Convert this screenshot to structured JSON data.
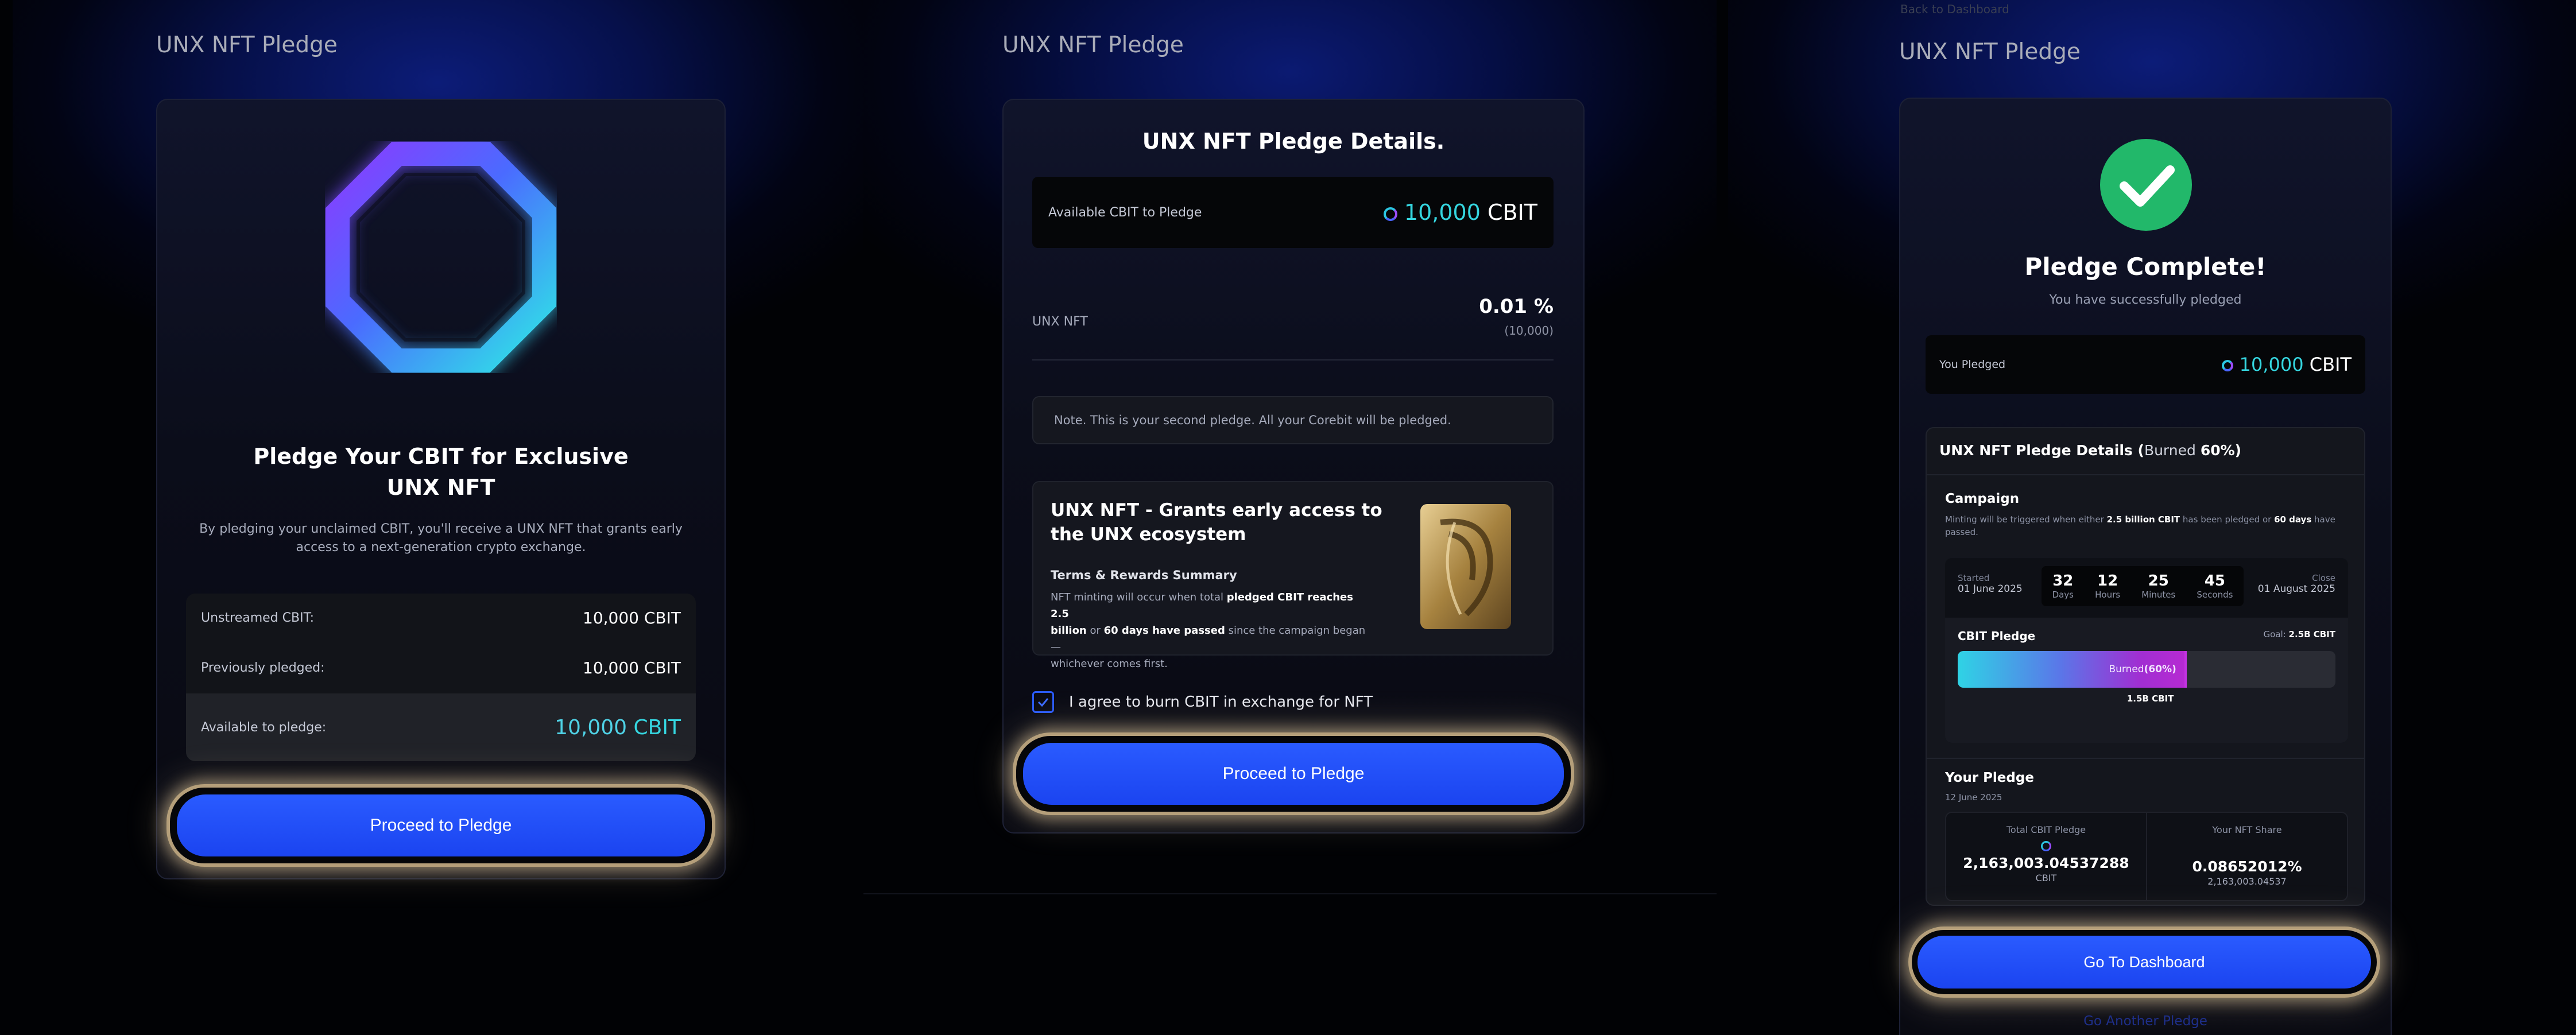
{
  "step1": {
    "title": "UNX NFT Pledge",
    "headline_line1": "Pledge Your CBIT for Exclusive",
    "headline_line2": "UNX NFT",
    "description_line1": "By pledging your unclaimed CBIT, you'll receive a UNX NFT that grants early",
    "description_line2": "access to a next-generation crypto exchange.",
    "rows": [
      {
        "label": "Unstreamed CBIT:",
        "value": "10,000 CBIT"
      },
      {
        "label": "Previously pledged:",
        "value": "10,000 CBIT"
      }
    ],
    "available_label": "Available to pledge:",
    "available_amount": "10,000",
    "available_unit": "CBIT",
    "button": "Proceed to Pledge"
  },
  "step2": {
    "title": "UNX NFT Pledge",
    "heading": "UNX NFT Pledge Details.",
    "available_label": "Available CBIT to Pledge",
    "available_amount": "10,000",
    "available_unit": "CBIT",
    "nft_label": "UNX NFT",
    "nft_percent": "0.01 %",
    "nft_sub": "(10,000)",
    "note": "Note. This is your second pledge. All your Corebit will be pledged.",
    "promo_title_line1": "UNX NFT - Grants early access to",
    "promo_title_line2": "the UNX ecosystem",
    "terms_title": "Terms & Rewards Summary",
    "terms_a": "NFT minting will occur when total ",
    "terms_b": "pledged CBIT reaches 2.5",
    "terms_c": "billion",
    "terms_d": " or ",
    "terms_e": "60 days have passed",
    "terms_f": " since the campaign began —",
    "terms_g": "whichever comes first.",
    "agree": "I agree to burn CBIT in exchange for NFT",
    "button": "Proceed to Pledge"
  },
  "step3": {
    "top_text": "Back to Dashboard",
    "title": "UNX NFT Pledge",
    "complete_title": "Pledge Complete!",
    "complete_sub": "You have successfully pledged",
    "you_pledged_label": "You Pledged",
    "you_pledged_amount": "10,000",
    "you_pledged_unit": "CBIT",
    "details_title": "UNX NFT Pledge Details (",
    "details_burned": "Burned ",
    "details_pct": "60%",
    "details_close": ")",
    "campaign_title": "Campaign",
    "campaign_a": "Minting will be triggered when either ",
    "campaign_b": "2.5 billion CBIT",
    "campaign_c": " has been pledged or ",
    "campaign_d": "60 days",
    "campaign_e": " have",
    "campaign_f": "passed.",
    "started_label": "Started",
    "started_date": "01 June 2025",
    "close_label": "Close",
    "close_date": "01 August 2025",
    "countdown": [
      {
        "n": "32",
        "l": "Days"
      },
      {
        "n": "12",
        "l": "Hours"
      },
      {
        "n": "25",
        "l": "Minutes"
      },
      {
        "n": "45",
        "l": "Seconds"
      }
    ],
    "cbit_pledge_label": "CBIT Pledge",
    "goal_label": "Goal: ",
    "goal_value": "2.5B CBIT",
    "bar_label": "Burned ",
    "bar_pct": "(60%)",
    "bar_progress": 0.6,
    "bar_marker": "1.5B CBIT",
    "your_pledge_title": "Your Pledge",
    "your_pledge_date": "12 June 2025",
    "total_label": "Total CBIT Pledge",
    "total_value": "2,163,003.04537288",
    "total_unit": "CBIT",
    "share_label": "Your NFT Share",
    "share_value": "0.08652012%",
    "share_sub": "2,163,003.04537",
    "button": "Go To Dashboard",
    "another": "Go Another Pledge"
  },
  "colors": {
    "accent": "#1f4bff",
    "cyan": "#35d6e0",
    "success": "#22b86a",
    "purple": "#9a2fd6"
  }
}
